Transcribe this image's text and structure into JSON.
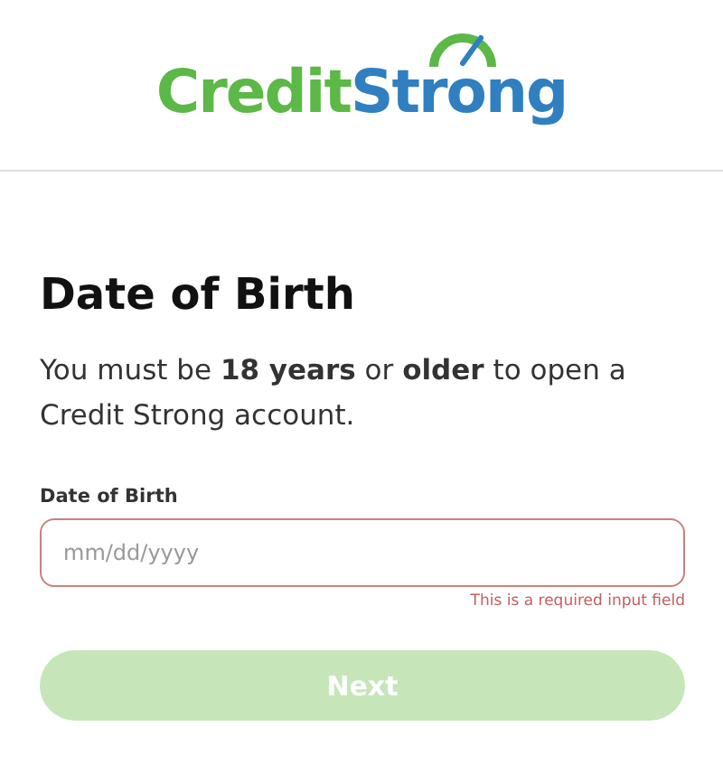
{
  "logo": {
    "first": "Credit",
    "second": "Strong"
  },
  "heading": "Date of Birth",
  "intro": "You must be **18 years** or **older** to open a Credit Strong account.",
  "field": {
    "label": "Date of Birth",
    "placeholder": "mm/dd/yyyy",
    "invalid": true,
    "error": "This is a required input field"
  },
  "next_button": {
    "label": "Next",
    "disabled": true
  }
}
